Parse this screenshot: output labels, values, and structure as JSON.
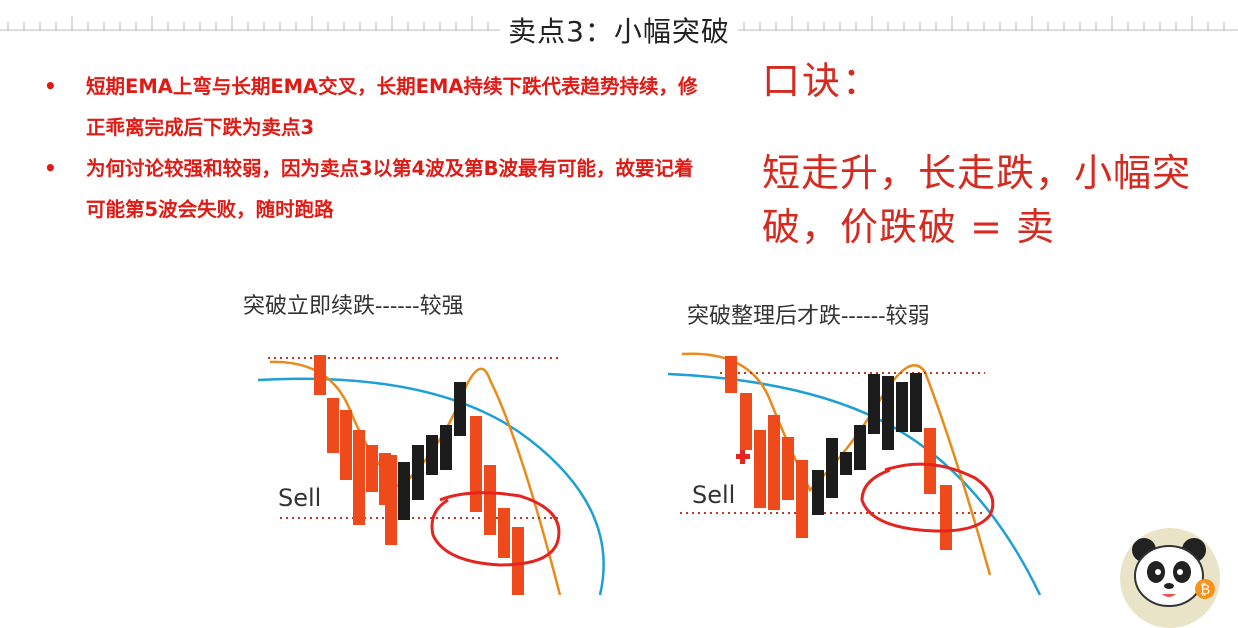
{
  "slide": {
    "title": "卖点3：小幅突破",
    "bullets": [
      "短期EMA上弯与长期EMA交叉，长期EMA持续下跌代表趋势持续，修正乖离完成后下跌为卖点3",
      "为何讨论较强和较弱，因为卖点3以第4波及第B波最有可能，故要记着可能第5波会失败，随时跑路"
    ],
    "koujue_title": "口诀：",
    "koujue_body": "短走升，长走跌，小幅突破，价跌破 = 卖"
  },
  "charts": [
    {
      "title": "突破立即续跌------较强",
      "sell_label": "Sell"
    },
    {
      "title": "突破整理后才跌------较弱",
      "sell_label": "Sell"
    }
  ],
  "colors": {
    "text_red": "#e01a14",
    "koujue_red": "#d42a20",
    "candle_red": "#ef4a1c",
    "candle_black": "#1c1c1c",
    "long_ema": "#1e9fd6",
    "short_ema": "#e98a1a",
    "circle": "#e5231f",
    "dotted_line": "#c0392b"
  },
  "icons": [
    "bullet-dot-icon",
    "panda-avatar-icon",
    "bitcoin-icon"
  ]
}
